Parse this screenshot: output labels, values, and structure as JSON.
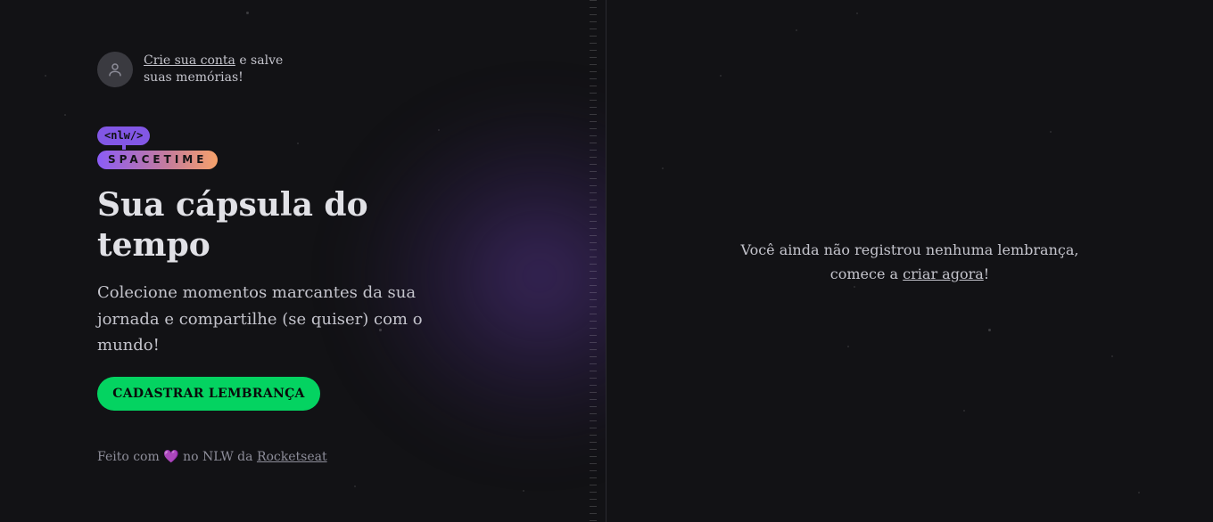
{
  "signin": {
    "link_label": "Crie sua conta",
    "text_after": " e salve",
    "text_line2": "suas memórias!"
  },
  "logo": {
    "top": "<nlw/>",
    "bottom": "SPACETIME"
  },
  "hero": {
    "title": "Sua cápsula do tempo",
    "description": "Colecione momentos marcantes da sua jornada e compartilhe (se quiser) com o mundo!",
    "cta_label": "CADASTRAR LEMBRANÇA"
  },
  "footer": {
    "prefix": "Feito com",
    "heart": "💜",
    "middle": "no NLW da",
    "link_label": "Rocketseat"
  },
  "empty_state": {
    "line1": "Você ainda não registrou nenhuma lembrança,",
    "line2_prefix": "comece a",
    "link_label": "criar agora",
    "line2_suffix": "!"
  },
  "colors": {
    "accent_green": "#04d361",
    "accent_purple": "#8257e5",
    "background": "#121215"
  }
}
